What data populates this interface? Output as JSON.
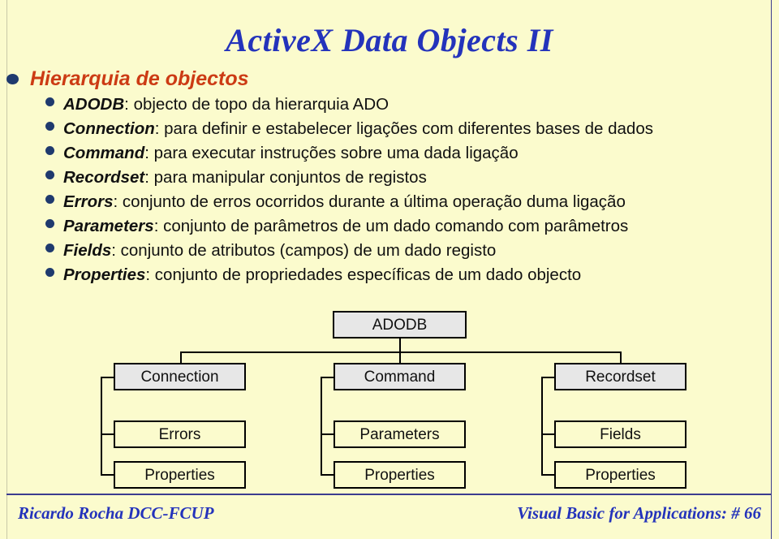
{
  "slide": {
    "title": "ActiveX Data Objects II",
    "heading": "Hierarquia de objectos",
    "background_color": "#fbfbcd",
    "title_color": "#2433bb",
    "heading_color": "#cc3b14",
    "bullet_color": "#1f3a6e",
    "rule_color": "#3b3b8f"
  },
  "bullets": [
    {
      "term": "ADODB",
      "desc": ": objecto de topo da hierarquia ADO"
    },
    {
      "term": "Connection",
      "desc": ": para definir e estabelecer ligações com diferentes bases de dados"
    },
    {
      "term": "Command",
      "desc": ": para executar instruções sobre uma dada ligação"
    },
    {
      "term": "Recordset",
      "desc": ": para manipular conjuntos de registos"
    },
    {
      "term": "Errors",
      "desc": ": conjunto de erros ocorridos durante a última operação duma ligação"
    },
    {
      "term": "Parameters",
      "desc": ": conjunto de parâmetros de um dado comando com parâmetros"
    },
    {
      "term": "Fields",
      "desc": ": conjunto de atributos (campos) de um dado registo"
    },
    {
      "term": "Properties",
      "desc": ": conjunto de propriedades específicas de um dado objecto"
    }
  ],
  "diagram": {
    "root": "ADODB",
    "columns": [
      {
        "parent": "Connection",
        "children": [
          "Errors",
          "Properties"
        ]
      },
      {
        "parent": "Command",
        "children": [
          "Parameters",
          "Properties"
        ]
      },
      {
        "parent": "Recordset",
        "children": [
          "Fields",
          "Properties"
        ]
      }
    ]
  },
  "footer": {
    "left": "Ricardo Rocha DCC-FCUP",
    "right": "Visual Basic for Applications: # 66"
  }
}
